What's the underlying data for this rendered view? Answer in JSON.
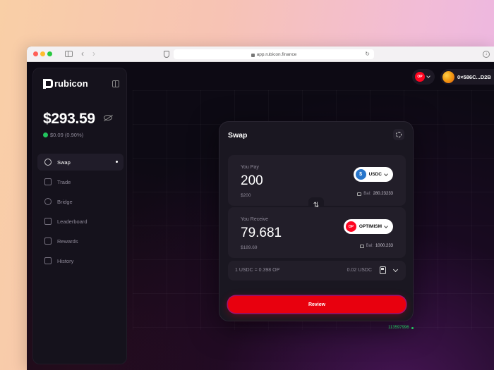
{
  "browser": {
    "url": "app.rubicon.finance"
  },
  "sidebar": {
    "logo_text": "rubicon",
    "balance": "$293.59",
    "change": "$0.09 (0.90%)",
    "items": [
      {
        "label": "Swap",
        "icon": "swap-icon",
        "active": true
      },
      {
        "label": "Trade",
        "icon": "trade-icon"
      },
      {
        "label": "Bridge",
        "icon": "bridge-icon"
      },
      {
        "label": "Leaderboard",
        "icon": "leaderboard-icon"
      },
      {
        "label": "Rewards",
        "icon": "rewards-icon"
      },
      {
        "label": "History",
        "icon": "history-icon"
      }
    ]
  },
  "header": {
    "network_badge": "OP",
    "wallet_address": "0×586C...D2B"
  },
  "swap": {
    "title": "Swap",
    "pay": {
      "label": "You Pay",
      "amount": "200",
      "usd_value": "$200",
      "token": "USDC",
      "balance_label": "Bal:",
      "balance": "280.23233"
    },
    "receive": {
      "label": "You Receive",
      "amount": "79.681",
      "usd_value": "$189.69",
      "token": "OPTIMISM",
      "token_badge": "OP",
      "balance_label": "Bal:",
      "balance": "1000.233"
    },
    "rate": "1 USDC = 0.398 OP",
    "fee": "0.02 USDC",
    "review_label": "Review"
  },
  "status": {
    "block_number": "113597996"
  },
  "colors": {
    "accent_red": "#e8000e",
    "op_red": "#ff0420",
    "usdc_blue": "#2775ca",
    "positive_green": "#22c55e"
  }
}
